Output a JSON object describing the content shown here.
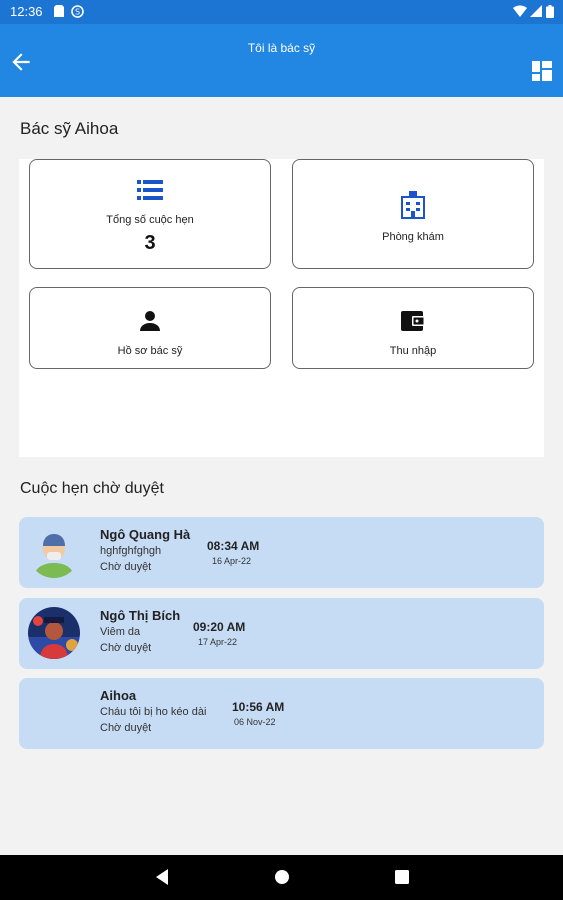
{
  "status_bar": {
    "time": "12:36"
  },
  "app_bar": {
    "title": "Tôi là bác sỹ"
  },
  "doctor": {
    "name": "Bác sỹ Aihoa"
  },
  "dashboard": {
    "total_appointments_label": "Tổng số cuộc hẹn",
    "total_appointments_value": "3",
    "clinic_label": "Phòng khám",
    "profile_label": "Hồ sơ bác sỹ",
    "income_label": "Thu nhập"
  },
  "pending": {
    "title": "Cuộc hẹn chờ duyệt",
    "items": [
      {
        "name": "Ngô Quang Hà",
        "reason": "hghfghfghgh",
        "status": "Chờ duyệt",
        "time": "08:34 AM",
        "date": "16 Apr-22"
      },
      {
        "name": "Ngô Thị Bích",
        "reason": "Viêm da",
        "status": "Chờ duyệt",
        "time": "09:20 AM",
        "date": "17 Apr-22"
      },
      {
        "name": "Aihoa",
        "reason": "Cháu tôi bị ho kéo dài",
        "status": "Chờ duyệt",
        "time": "10:56 AM",
        "date": "06 Nov-22"
      }
    ]
  },
  "colors": {
    "app_bar": "#2187e3",
    "status_bar": "#1c74d3",
    "card": "#c6dcf5",
    "icon_blue": "#1a56c9"
  }
}
